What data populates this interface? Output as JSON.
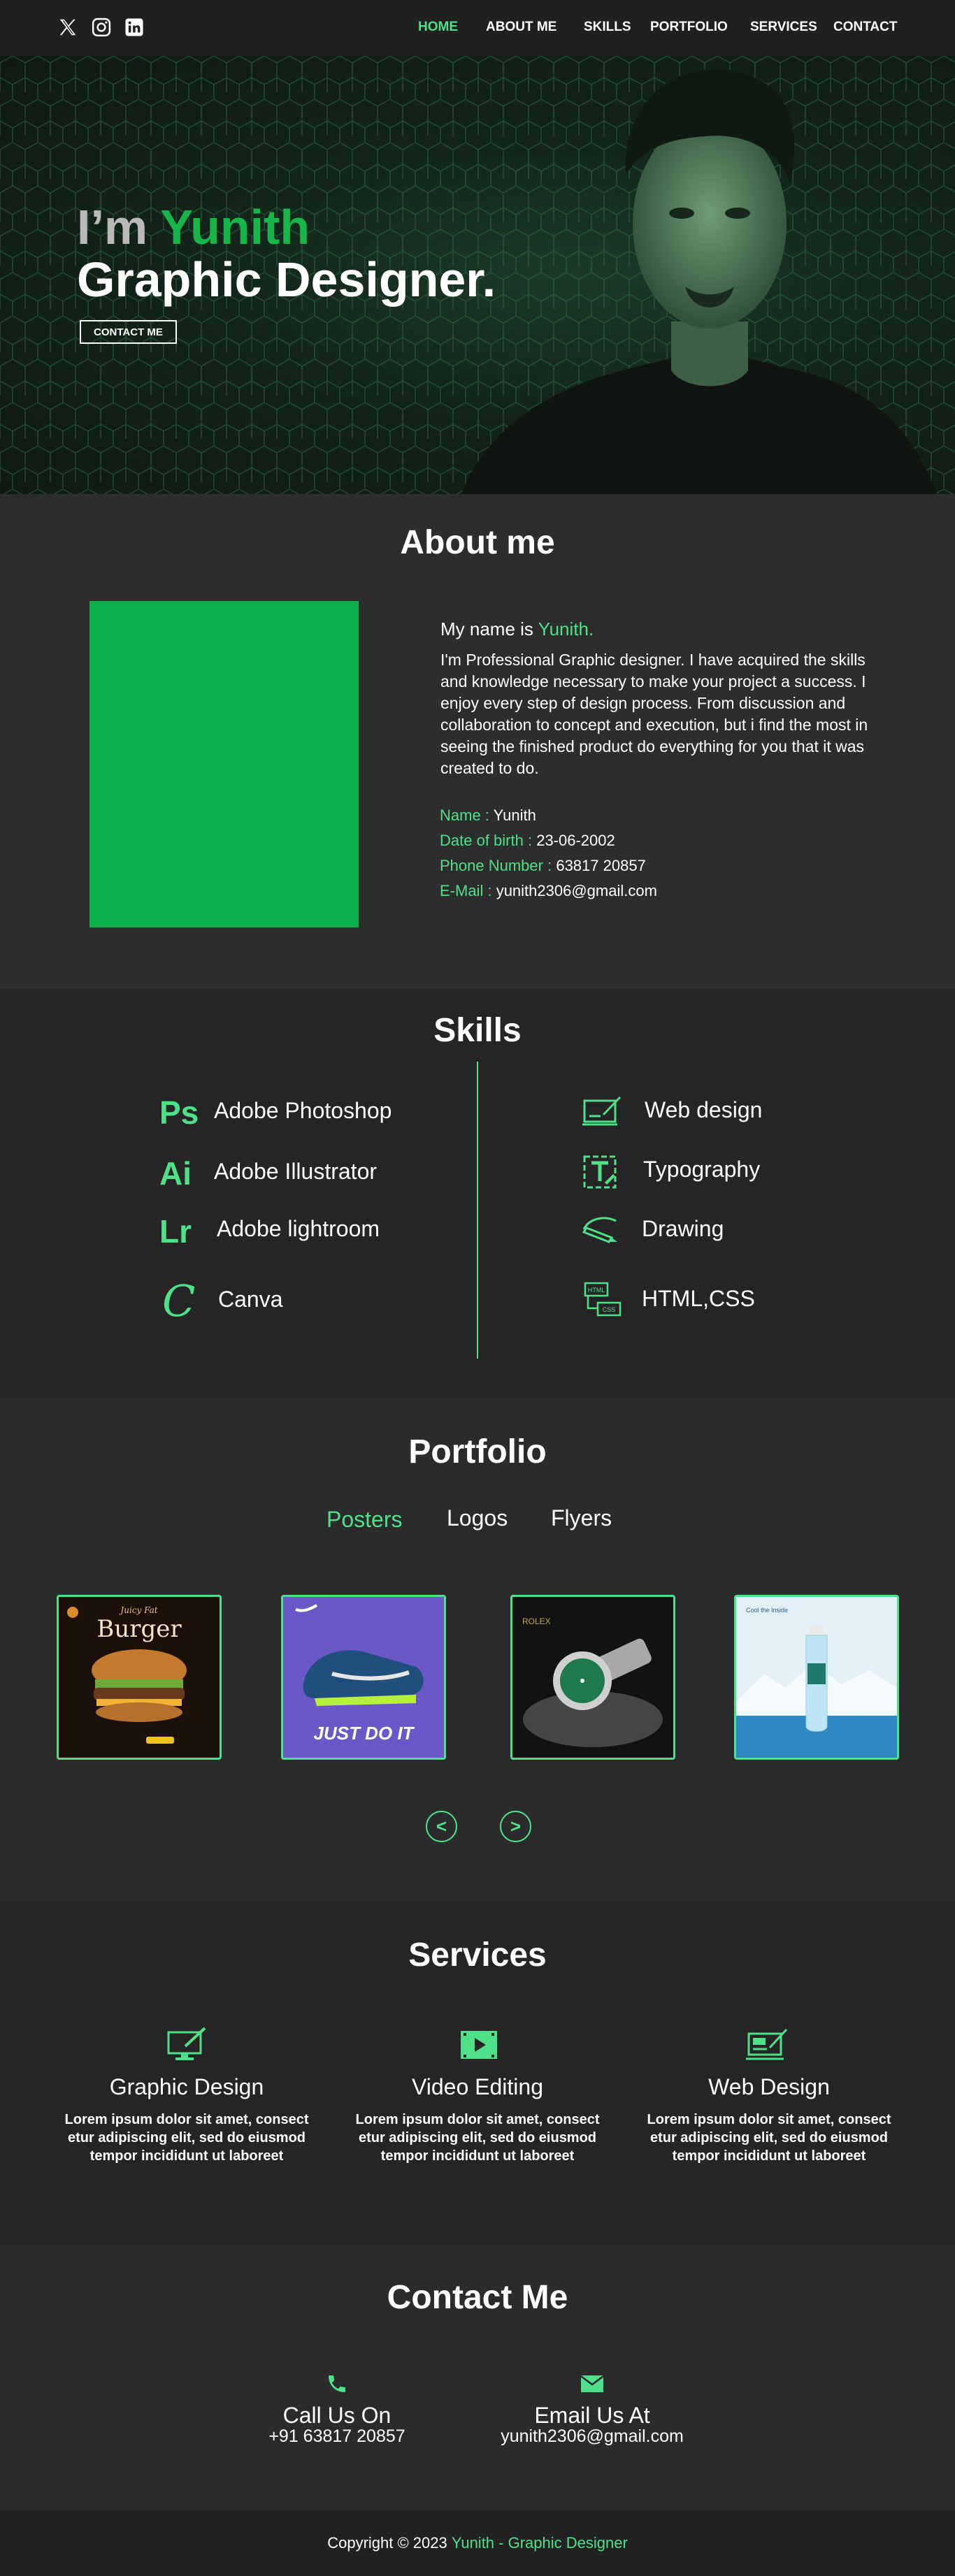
{
  "nav": {
    "social": [
      "x-icon",
      "instagram-icon",
      "linkedin-icon"
    ],
    "links": [
      {
        "label": "HOME",
        "active": true
      },
      {
        "label": "ABOUT ME",
        "active": false
      },
      {
        "label": "SKILLS",
        "active": false
      },
      {
        "label": "PORTFOLIO",
        "active": false
      },
      {
        "label": "SERVICES",
        "active": false
      },
      {
        "label": "CONTACT",
        "active": false
      }
    ]
  },
  "hero": {
    "greeting": "I’m",
    "name": "Yunith",
    "role": "Graphic Designer.",
    "button": "CONTACT ME"
  },
  "about": {
    "title": "About me",
    "intro_prefix": "My name is",
    "intro_name": "Yunith.",
    "bio": "I'm Professional Graphic designer. I have acquired the skills and knowledge necessary to make your project a success. I enjoy every step of design process. From discussion and collaboration to concept and execution, but i find the most in seeing the finished product do everything for you that it was created to do.",
    "info": [
      {
        "key": "Name :",
        "value": "Yunith"
      },
      {
        "key": "Date of birth :",
        "value": "23-06-2002"
      },
      {
        "key": "Phone Number :",
        "value": "63817 20857"
      },
      {
        "key": "E-Mail :",
        "value": "yunith2306@gmail.com"
      }
    ]
  },
  "skills": {
    "title": "Skills",
    "left": [
      {
        "icon": "Ps",
        "label": "Adobe Photoshop"
      },
      {
        "icon": "Ai",
        "label": "Adobe Illustrator"
      },
      {
        "icon": "Lr",
        "label": "Adobe lightroom"
      },
      {
        "icon": "C",
        "label": "Canva"
      }
    ],
    "right": [
      {
        "icon": "web-design-icon",
        "label": "Web design"
      },
      {
        "icon": "typography-icon",
        "label": "Typography"
      },
      {
        "icon": "drawing-icon",
        "label": "Drawing"
      },
      {
        "icon": "html-css-icon",
        "label": "HTML,CSS"
      }
    ]
  },
  "portfolio": {
    "title": "Portfolio",
    "tabs": [
      "Posters",
      "Logos",
      "Flyers"
    ],
    "active_tab": "Posters",
    "cards": [
      {
        "icon": "burger-poster-image",
        "caption_top": "Juicy Fat",
        "caption": "Burger"
      },
      {
        "icon": "shoe-poster-image",
        "caption": "JUST DO IT"
      },
      {
        "icon": "watch-poster-image",
        "caption": "ROLEX"
      },
      {
        "icon": "water-bottle-poster-image",
        "caption": "Cool the Inside"
      }
    ],
    "prev": "<",
    "next": ">"
  },
  "services": {
    "title": "Services",
    "items": [
      {
        "icon": "graphic-design-icon",
        "title": "Graphic Design",
        "text": "Lorem ipsum dolor sit amet, consect etur adipiscing elit, sed do eiusmod tempor incididunt ut laboreet"
      },
      {
        "icon": "video-editing-icon",
        "title": "Video Editing",
        "text": "Lorem ipsum dolor sit amet, consect etur adipiscing elit, sed do eiusmod tempor incididunt ut laboreet"
      },
      {
        "icon": "web-design-icon",
        "title": "Web Design",
        "text": "Lorem ipsum dolor sit amet, consect etur adipiscing elit, sed do eiusmod tempor incididunt ut laboreet"
      }
    ]
  },
  "contact": {
    "title": "Contact Me",
    "phone": {
      "icon": "phone-icon",
      "label": "Call Us On",
      "value": "+91 63817 20857"
    },
    "email": {
      "icon": "mail-icon",
      "label": "Email Us At",
      "value": "yunith2306@gmail.com"
    }
  },
  "footer": {
    "copyright": "Copyright © 2023",
    "brand": "Yunith - Graphic Designer"
  },
  "colors": {
    "accent": "#4fe08a",
    "brand_green": "#0db14b",
    "bg": "#2b2b2b",
    "nav_bg": "#202020"
  }
}
